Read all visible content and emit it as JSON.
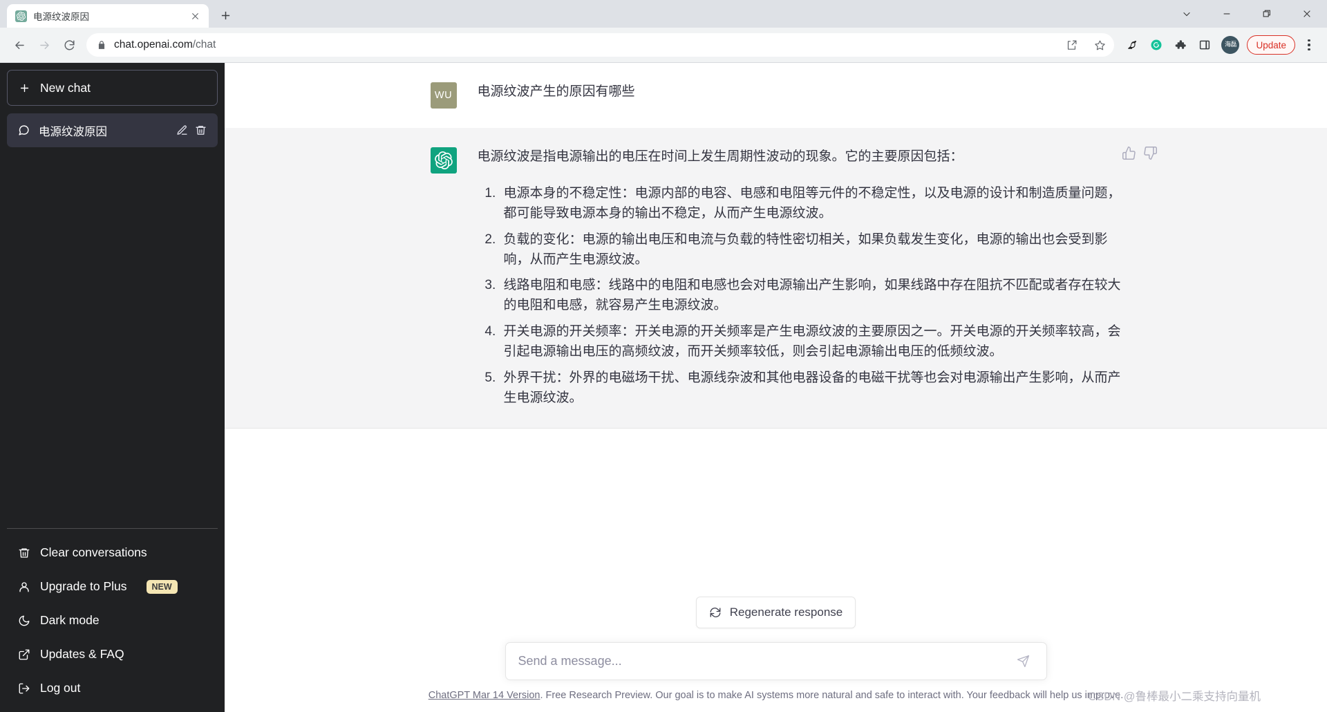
{
  "browser": {
    "tab": {
      "title": "电源纹波原因",
      "favicon_icon": "openai-logo-icon",
      "close_icon": "close-icon"
    },
    "new_tab_icon": "plus-icon",
    "window_controls": [
      {
        "name": "chevron-down-icon",
        "glyph": "chevron-down"
      },
      {
        "name": "minimize-icon",
        "glyph": "minimize"
      },
      {
        "name": "restore-icon",
        "glyph": "restore"
      },
      {
        "name": "close-icon",
        "glyph": "close"
      }
    ],
    "nav": {
      "back_icon": "back-arrow-icon",
      "forward_icon": "forward-arrow-icon",
      "reload_icon": "reload-icon"
    },
    "omnibox": {
      "lock_icon": "lock-icon",
      "url_host": "chat.openai.com",
      "url_path": "/chat",
      "share_icon": "share-icon",
      "bookmark_icon": "star-icon"
    },
    "extensions": [
      {
        "name": "bird-extension-icon"
      },
      {
        "name": "grammarly-extension-icon"
      },
      {
        "name": "puzzle-extensions-icon"
      },
      {
        "name": "side-panel-icon"
      }
    ],
    "profile": {
      "name": "profile-avatar",
      "initials": "海磊"
    },
    "update_button": {
      "label": "Update"
    },
    "menu_icon": "kebab-menu-icon"
  },
  "sidebar": {
    "new_chat": {
      "label": "New chat",
      "icon": "plus-icon"
    },
    "conversations": [
      {
        "title": "电源纹波原因",
        "icon": "chat-bubble-icon",
        "edit_icon": "pencil-icon",
        "delete_icon": "trash-icon",
        "active": true
      }
    ],
    "footer_items": [
      {
        "label": "Clear conversations",
        "icon": "trash-icon",
        "badge": ""
      },
      {
        "label": "Upgrade to Plus",
        "icon": "person-icon",
        "badge": "NEW"
      },
      {
        "label": "Dark mode",
        "icon": "moon-icon",
        "badge": ""
      },
      {
        "label": "Updates & FAQ",
        "icon": "external-link-icon",
        "badge": ""
      },
      {
        "label": "Log out",
        "icon": "logout-icon",
        "badge": ""
      }
    ]
  },
  "chat": {
    "messages": [
      {
        "role": "user",
        "avatar_initials": "WU",
        "text": "电源纹波产生的原因有哪些"
      },
      {
        "role": "assistant",
        "avatar_icon": "openai-logo-icon",
        "intro": "电源纹波是指电源输出的电压在时间上发生周期性波动的现象。它的主要原因包括：",
        "items": [
          "电源本身的不稳定性：电源内部的电容、电感和电阻等元件的不稳定性，以及电源的设计和制造质量问题，都可能导致电源本身的输出不稳定，从而产生电源纹波。",
          "负载的变化：电源的输出电压和电流与负载的特性密切相关，如果负载发生变化，电源的输出也会受到影响，从而产生电源纹波。",
          "线路电阻和电感：线路中的电阻和电感也会对电源输出产生影响，如果线路中存在阻抗不匹配或者存在较大的电阻和电感，就容易产生电源纹波。",
          "开关电源的开关频率：开关电源的开关频率是产生电源纹波的主要原因之一。开关电源的开关频率较高，会引起电源输出电压的高频纹波，而开关频率较低，则会引起电源输出电压的低频纹波。",
          "外界干扰：外界的电磁场干扰、电源线杂波和其他电器设备的电磁干扰等也会对电源输出产生影响，从而产生电源纹波。"
        ],
        "feedback": {
          "thumbs_up_icon": "thumbs-up-icon",
          "thumbs_down_icon": "thumbs-down-icon"
        }
      }
    ]
  },
  "composer": {
    "regenerate_label": "Regenerate response",
    "regenerate_icon": "refresh-icon",
    "input_placeholder": "Send a message...",
    "input_value": "",
    "send_icon": "send-icon"
  },
  "footer": {
    "link_text": "ChatGPT Mar 14 Version",
    "rest_text": ". Free Research Preview. Our goal is to make AI systems more natural and safe to interact with. Your feedback will help us improve."
  },
  "watermark": {
    "text": "CSDN @鲁棒最小二乘支持向量机"
  },
  "colors": {
    "sidebar_bg": "#202123",
    "active_chat_bg": "#343541",
    "assistant_bg": "#f4f4f5",
    "brand_green": "#10a37f",
    "user_avatar": "#9b9b7a",
    "badge_new": "#f5e6b3",
    "update_accent": "#d93025"
  }
}
